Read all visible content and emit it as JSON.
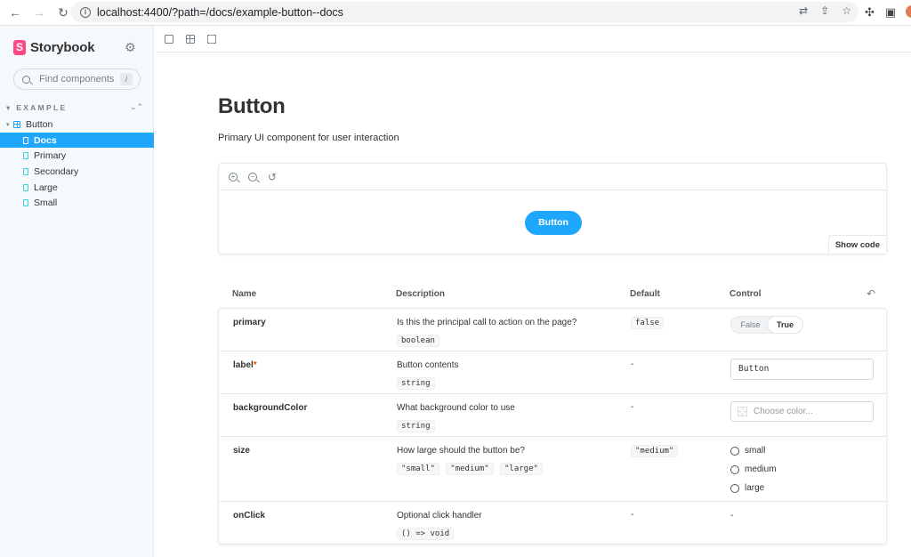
{
  "browser": {
    "url": "localhost:4400/?path=/docs/example-button--docs"
  },
  "sidebar": {
    "brand": "Storybook",
    "search_placeholder": "Find components",
    "search_shortcut": "/",
    "group_title": "EXAMPLE",
    "component": "Button",
    "stories": [
      {
        "label": "Docs",
        "selected": true,
        "kind": "doc"
      },
      {
        "label": "Primary",
        "selected": false,
        "kind": "story"
      },
      {
        "label": "Secondary",
        "selected": false,
        "kind": "story"
      },
      {
        "label": "Large",
        "selected": false,
        "kind": "story"
      },
      {
        "label": "Small",
        "selected": false,
        "kind": "story"
      }
    ]
  },
  "docs": {
    "title": "Button",
    "subtitle": "Primary UI component for user interaction",
    "preview_button_label": "Button",
    "show_code": "Show code"
  },
  "args": {
    "headers": {
      "name": "Name",
      "description": "Description",
      "default": "Default",
      "control": "Control"
    },
    "rows": [
      {
        "name": "primary",
        "description": "Is this the principal call to action on the page?",
        "type": "boolean",
        "default": "false",
        "toggle": {
          "off": "False",
          "on": "True",
          "value": "True"
        }
      },
      {
        "name": "label",
        "required": "*",
        "description": "Button contents",
        "type": "string",
        "default": "-",
        "value": "Button"
      },
      {
        "name": "backgroundColor",
        "description": "What background color to use",
        "type": "string",
        "default": "-",
        "color_placeholder": "Choose color..."
      },
      {
        "name": "size",
        "description": "How large should the button be?",
        "types": [
          "\"small\"",
          "\"medium\"",
          "\"large\""
        ],
        "default": "\"medium\"",
        "options": [
          "small",
          "medium",
          "large"
        ]
      },
      {
        "name": "onClick",
        "description": "Optional click handler",
        "type": "() => void",
        "default": "-",
        "control": "-"
      }
    ]
  },
  "colors": {
    "accent": "#1ea7fd",
    "brand": "#ff4785",
    "sidebar_bg": "#f6f9fc"
  }
}
